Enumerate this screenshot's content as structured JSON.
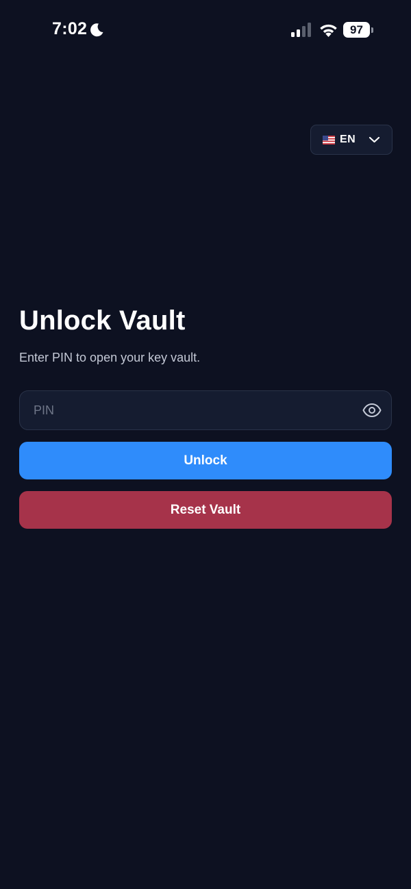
{
  "status_bar": {
    "time": "7:02",
    "battery_level": "97",
    "icons": [
      "moon-icon",
      "signal-icon",
      "wifi-icon",
      "battery-icon"
    ]
  },
  "language_selector": {
    "flag": "us-flag-icon",
    "code": "EN"
  },
  "unlock": {
    "title": "Unlock Vault",
    "subtitle": "Enter PIN to open your key vault.",
    "pin_placeholder": "PIN",
    "pin_value": "",
    "unlock_label": "Unlock",
    "reset_label": "Reset Vault"
  },
  "colors": {
    "background": "#0d1121",
    "field_background": "#151c30",
    "unlock_button": "#2f8cfb",
    "reset_button": "#a6334a"
  }
}
